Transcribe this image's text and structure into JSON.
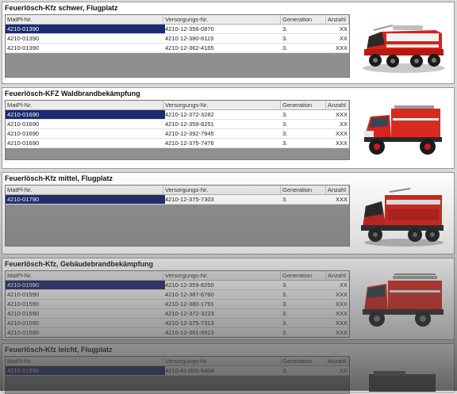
{
  "columns": {
    "matpl": "MatPl-Nr.",
    "versorgung": "Versorgungs-Nr.",
    "generation": "Generation",
    "anzahl": "Anzahl"
  },
  "panels": [
    {
      "title": "Feuerlösch-Kfz schwer, Flugplatz",
      "vehicle_icon": "airport-crash-tender",
      "rows": [
        {
          "matpl": "4210-01390",
          "versorgung": "4210-12-356-0870",
          "generation": "3.",
          "anzahl": "XX"
        },
        {
          "matpl": "4210-01390",
          "versorgung": "4210-12-380-8119",
          "generation": "3.",
          "anzahl": "XX"
        },
        {
          "matpl": "4210-01390",
          "versorgung": "4210-12-362-4165",
          "generation": "3.",
          "anzahl": "XXX"
        }
      ]
    },
    {
      "title": "Feuerlösch-KFZ Waldbrandbekämpfung",
      "vehicle_icon": "forest-fire-truck",
      "rows": [
        {
          "matpl": "4210-01690",
          "versorgung": "4210-12-372-3282",
          "generation": "3.",
          "anzahl": "XXX"
        },
        {
          "matpl": "4210-01690",
          "versorgung": "4210-12-359-8251",
          "generation": "3.",
          "anzahl": "XX"
        },
        {
          "matpl": "4210-01690",
          "versorgung": "4210-12-392-7945",
          "generation": "3.",
          "anzahl": "XXX"
        },
        {
          "matpl": "4210-01690",
          "versorgung": "4210-12-375-7476",
          "generation": "3.",
          "anzahl": "XXX"
        }
      ]
    },
    {
      "title": "Feuerlösch-Kfz mittel, Flugplatz",
      "vehicle_icon": "airport-fire-truck",
      "rows": [
        {
          "matpl": "4210-01790",
          "versorgung": "4210-12-375-7303",
          "generation": "3.",
          "anzahl": "XXX"
        }
      ]
    },
    {
      "title": "Feuerlösch-Kfz, Gebäudebrandbekämpfung",
      "vehicle_icon": "building-fire-truck",
      "rows": [
        {
          "matpl": "4210-01590",
          "versorgung": "4210-12-359-8250",
          "generation": "3.",
          "anzahl": "XX"
        },
        {
          "matpl": "4210-01590",
          "versorgung": "4210-12-387-6760",
          "generation": "3.",
          "anzahl": "XXX"
        },
        {
          "matpl": "4210-01590",
          "versorgung": "4210-12-380-1791",
          "generation": "3.",
          "anzahl": "XXX"
        },
        {
          "matpl": "4210-01590",
          "versorgung": "4210-12-372-3223",
          "generation": "3.",
          "anzahl": "XXX"
        },
        {
          "matpl": "4210-01590",
          "versorgung": "4210-12-375-7313",
          "generation": "3.",
          "anzahl": "XXX"
        },
        {
          "matpl": "4210-01590",
          "versorgung": "4210-12-361-8913",
          "generation": "3.",
          "anzahl": "XXX"
        }
      ]
    },
    {
      "title": "Feuerlösch-Kfz leicht, Flugplatz",
      "vehicle_icon": "light-airport-fire-truck",
      "rows": [
        {
          "matpl": "4210-01990",
          "versorgung": "4210-41-000-9404",
          "generation": "3.",
          "anzahl": "XX"
        }
      ]
    }
  ]
}
